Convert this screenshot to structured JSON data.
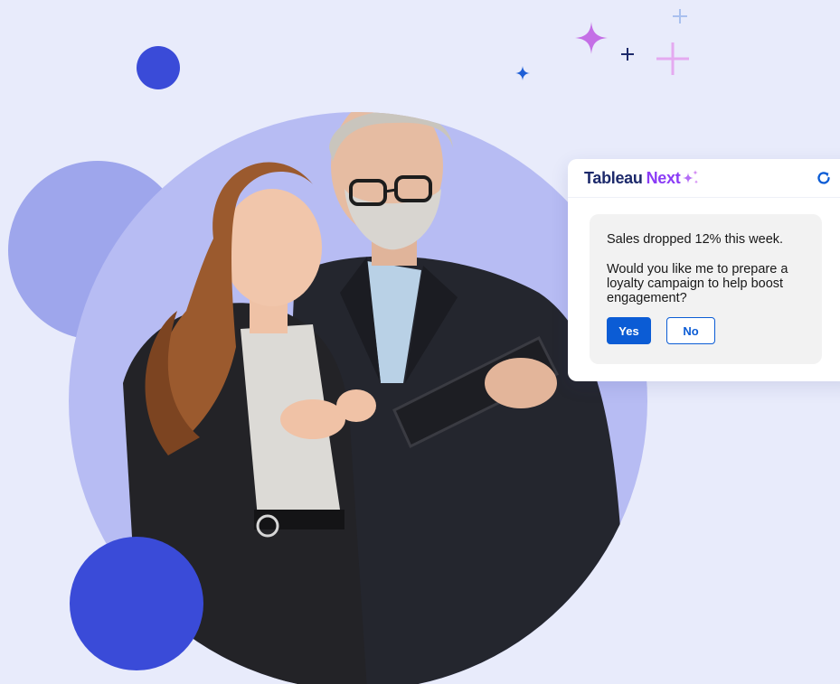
{
  "chat": {
    "brand_name": "Tableau",
    "brand_suffix": "Next",
    "message_line1": "Sales dropped 12% this week.",
    "message_line2": "Would you like me to prepare a loyalty campaign to help boost engagement?",
    "yes_label": "Yes",
    "no_label": "No"
  },
  "icons": {
    "brand": "sparkle-icon",
    "refresh": "refresh-icon",
    "decor": "plus-sparkle-icon"
  },
  "colors": {
    "background": "#e8ebfb",
    "accent_blue": "#0b5cd5",
    "brand_navy": "#1d2a6b",
    "brand_purple": "#8b3cf6",
    "deco_blue_dark": "#3a4bd8",
    "deco_blue_light": "#9ea6ec",
    "photo_backdrop": "#b7bcf3"
  }
}
